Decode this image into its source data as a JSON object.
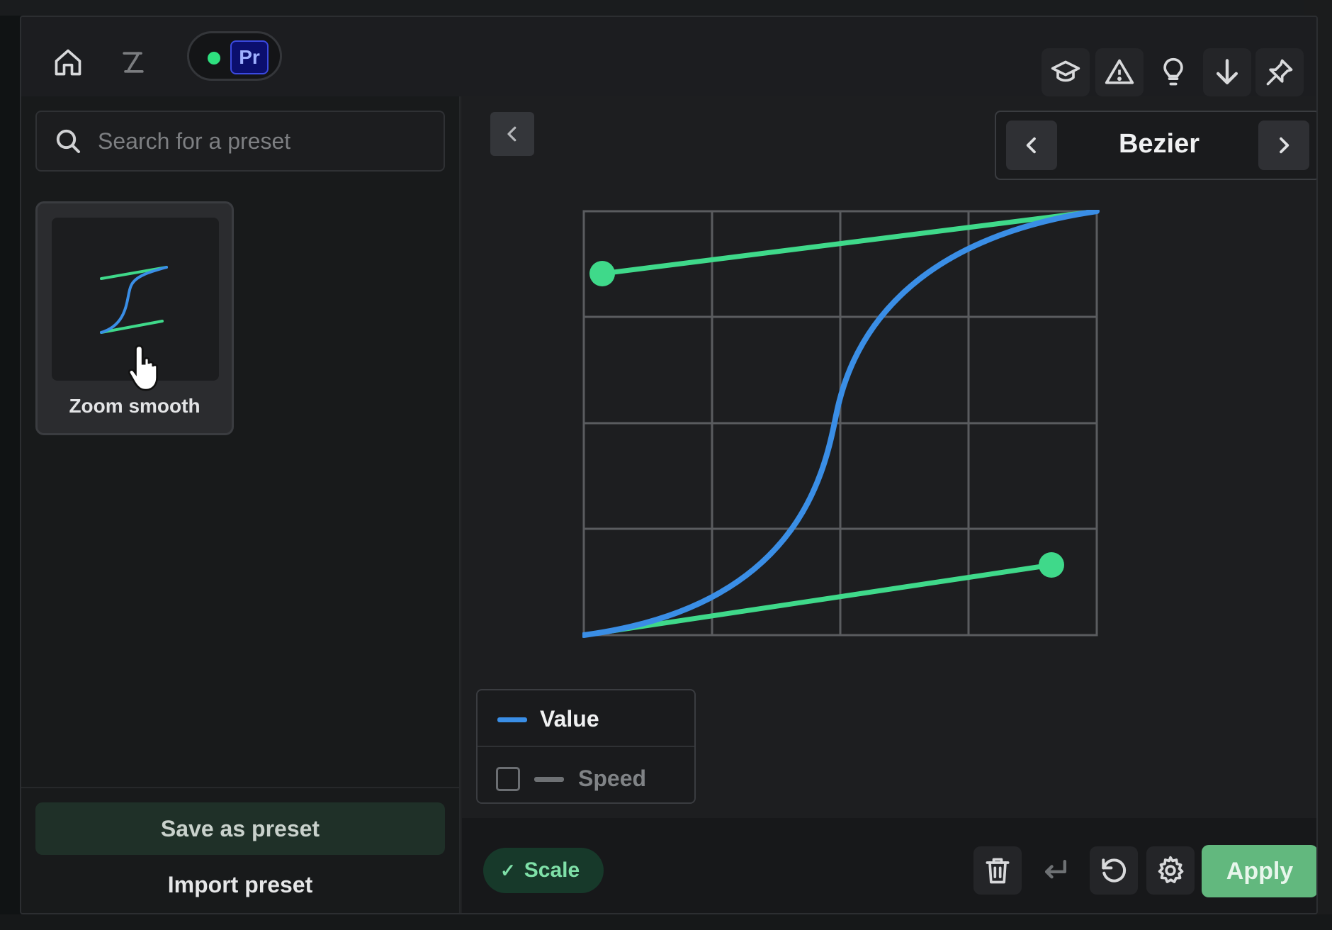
{
  "app": {
    "host_app_badge": "Pr",
    "status_color": "#2ee07f"
  },
  "sidebar": {
    "search_placeholder": "Search for a preset",
    "presets": [
      {
        "label": "Zoom smooth"
      }
    ],
    "save_label": "Save as preset",
    "import_label": "Import preset"
  },
  "editor": {
    "curve_type": "Bezier",
    "legend": {
      "value_label": "Value",
      "speed_label": "Speed",
      "speed_checked": false
    },
    "property_chip": "Scale",
    "apply_label": "Apply",
    "colors": {
      "value_curve": "#3a8ee6",
      "handles": "#3fd98a",
      "apply": "#62b87e"
    }
  }
}
